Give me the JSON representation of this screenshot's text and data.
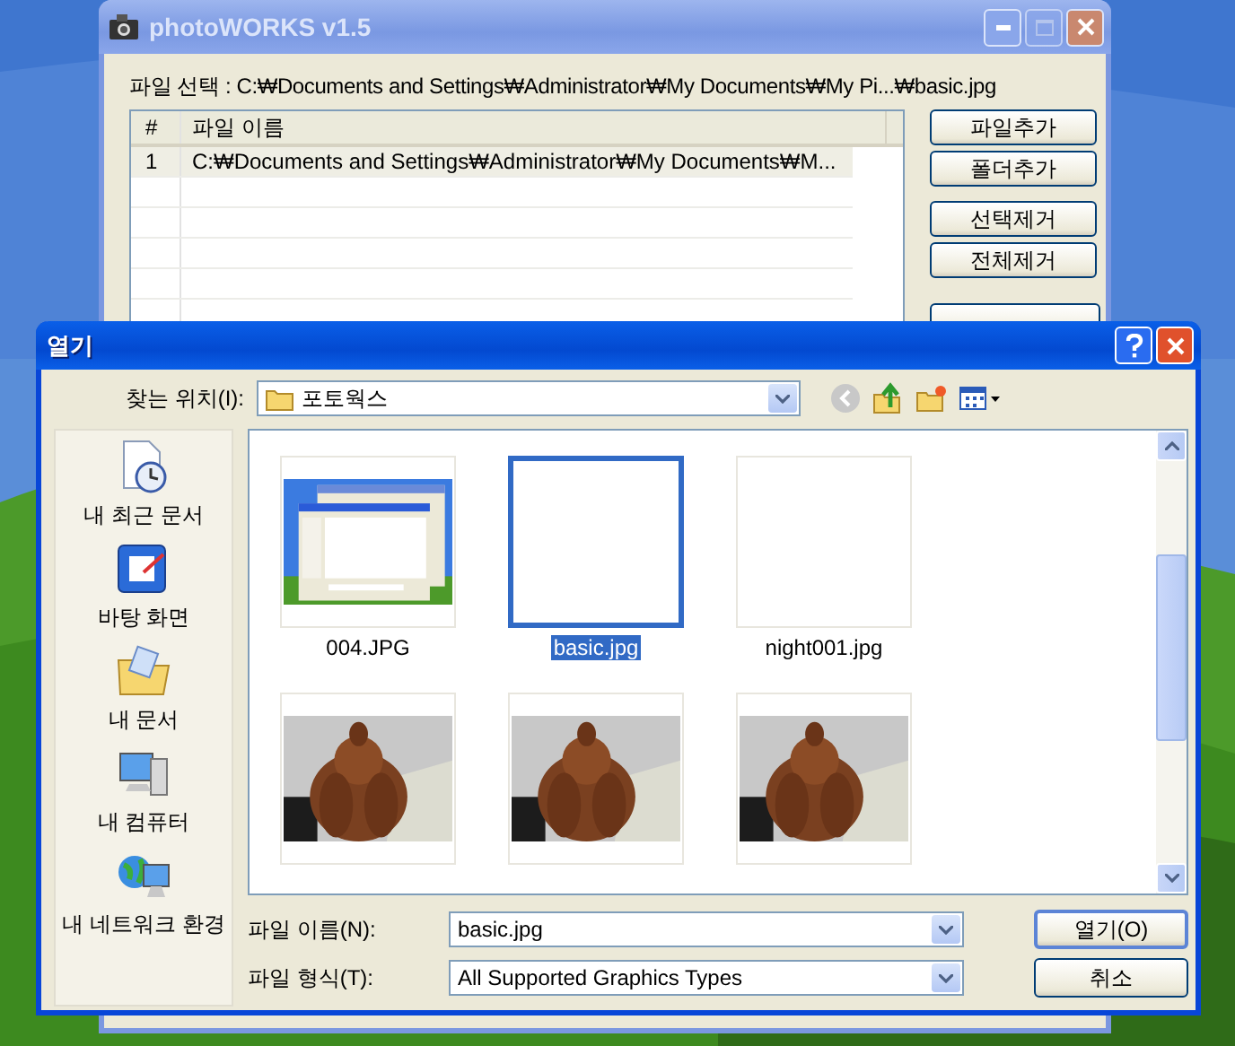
{
  "main_window": {
    "title": "photoWORKS v1.5",
    "active": false,
    "file_selection": "파일 선택 : C:₩Documents and Settings₩Administrator₩My Documents₩My Pi...₩basic.jpg",
    "table": {
      "columns": [
        "#",
        "파일 이름"
      ],
      "rows": [
        {
          "cells": [
            "1",
            "C:₩Documents and Settings₩Administrator₩My Documents₩M..."
          ],
          "selected": true
        }
      ]
    },
    "buttons": [
      "파일추가",
      "폴더추가",
      "선택제거",
      "전체제거"
    ]
  },
  "dialog": {
    "title": "열기",
    "active": true,
    "look_in_label": "찾는 위치(I):",
    "look_in_value": "포토웍스",
    "places": [
      {
        "kind": "recent",
        "label": "내 최근 문서"
      },
      {
        "kind": "desktop",
        "label": "바탕 화면"
      },
      {
        "kind": "documents",
        "label": "내 문서"
      },
      {
        "kind": "computer",
        "label": "내 컴퓨터"
      },
      {
        "kind": "network",
        "label": "내 네트워크 환경"
      }
    ],
    "files": [
      {
        "kind": "screenshot",
        "name": "004.JPG",
        "selected": false
      },
      {
        "kind": "blank",
        "name": "basic.jpg",
        "selected": true
      },
      {
        "kind": "blank",
        "name": "night001.jpg",
        "selected": false
      },
      {
        "kind": "picture",
        "selected": false
      },
      {
        "kind": "picture",
        "selected": false
      },
      {
        "kind": "picture",
        "selected": false
      }
    ],
    "file_name_label": "파일 이름(N):",
    "file_name_value": "basic.jpg",
    "file_type_label": "파일 형식(T):",
    "file_type_value": "All Supported Graphics Types",
    "buttons": [
      "열기(O)",
      "취소"
    ]
  }
}
